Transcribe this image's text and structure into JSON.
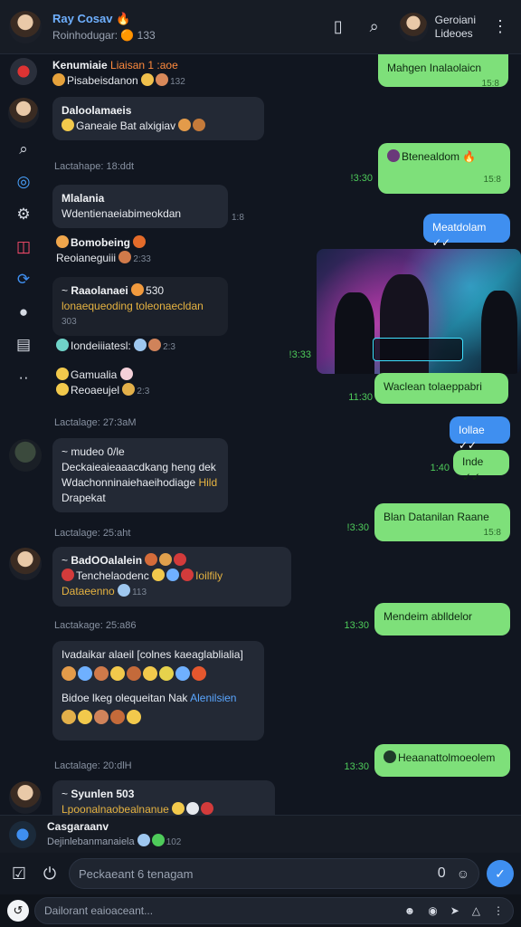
{
  "header": {
    "title": "Ray Cosav 🔥",
    "subtitle": "Roinhodugar: 🟠 133",
    "user_name": "Geroiani",
    "user_sub": "Lideoes"
  },
  "rail": [
    "search-icon",
    "compass-icon",
    "settings-icon",
    "bookmark-icon",
    "sync-icon",
    "profile-icon",
    "chart-icon",
    "more-icon"
  ],
  "messages": {
    "m1": {
      "name": "Kenumiaie",
      "tag": "Liaisan 1 :aoe",
      "text": "Pisabeisdanon",
      "meta": "132"
    },
    "m2": {
      "name": "Daloolamaeis",
      "text": "Ganeaie Bat alxigiav"
    },
    "stamp1": "Lactahape:  18:ddt",
    "m3": {
      "name": "Mlalania",
      "text": "Wdentienaeiabimeokdan",
      "meta": "1:8"
    },
    "m4": {
      "name": "Bomobeing",
      "text": "Reoianeguiii",
      "meta": "2:33"
    },
    "m5": {
      "name": "Raaolanaei",
      "tag": "530",
      "text": "lonaequeoding toleonaecldan",
      "meta": "303"
    },
    "m6": {
      "text": "Iondeiiiatesl:",
      "meta": "2:3"
    },
    "m7": {
      "name": "Gamualia",
      "text": "Reoaeujel",
      "meta": "2:3"
    },
    "stamp2": "Lactalage:  27:3aM",
    "m8": {
      "name": "mudeo 0/le",
      "line1": "Deckaieaieaaacdkang heng dek",
      "line2": "Wdachonninaiehaeihodiage",
      "hl": "Hild",
      "line3": "Drapekat"
    },
    "stamp3": "Lactalage:  25:aht",
    "m9": {
      "name": "BadOOalalein",
      "text": "Tenchelaodenc",
      "hl": "Ioilfily",
      "line2": "Dataeenno",
      "meta": "113"
    },
    "stamp4": "Lactakage:  25:a86",
    "m10": {
      "line1": "Ivadaikar alaeil [colnes kaeaglablialia]",
      "line2": "Bidoe lkeg olequeitan Nak",
      "hl": "Alenilsien"
    },
    "stamp5": "Lactalage:  20:dlH",
    "m11": {
      "name": "Syunlen 503",
      "text": "Lpoonalnaobealnanue",
      "meta": ""
    },
    "o1": {
      "text": "Mahgen Inalaolaicn",
      "meta": "15:8"
    },
    "o2": {
      "text": "Btenealdom 🔥",
      "meta": "15:8",
      "side": "!3:30"
    },
    "b1": {
      "text": "Meatdolam ✓✓"
    },
    "o3": {
      "text": "Waclean tolaeppabri",
      "side": "11:30"
    },
    "b2": {
      "text": "Iollae ✓✓"
    },
    "o4": {
      "text": "Inde ✓✓",
      "side": "1:40"
    },
    "o5": {
      "text": "Blan Datanilan Raane",
      "meta": "15:8",
      "side": "!3:30"
    },
    "o6": {
      "text": "Mendeim ablldelor",
      "side": "13:30"
    },
    "o7": {
      "text": "Heaanattolmoeolem",
      "side": "13:30"
    },
    "photo_side": "!3:33"
  },
  "preview": {
    "name": "Casgaraanv",
    "text": "Dejinlebanmanaiela",
    "meta": "102"
  },
  "input": {
    "placeholder": "Peckaeant 6 tenagam",
    "count": "0"
  },
  "bottom": {
    "placeholder": "Dailorant eaioaceant..."
  },
  "colors": {
    "accent": "#3f8ff0",
    "out_bubble": "#7ee07a",
    "in_bubble": "#232935"
  }
}
